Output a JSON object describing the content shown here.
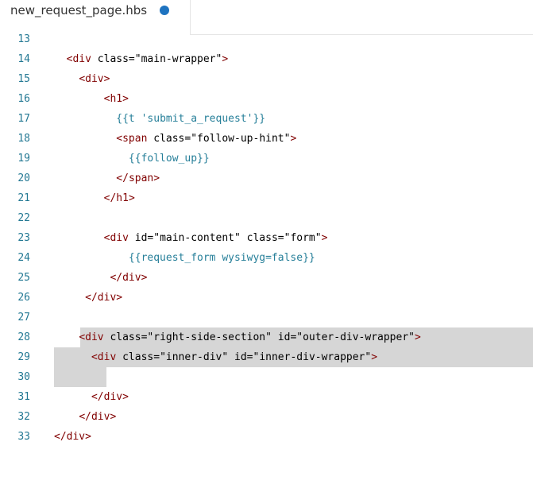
{
  "tab": {
    "title": "new_request_page.hbs",
    "dirty_indicator": "unsaved-dot"
  },
  "colors": {
    "line_number": "#237893",
    "tag": "#800000",
    "attribute": "#e50000",
    "string": "#a31515",
    "selection": "#d6d6d6",
    "dirty_dot": "#1e73c0"
  },
  "lines": [
    {
      "num": "13",
      "text": ""
    },
    {
      "num": "14",
      "text": "  <div class=\"main-wrapper\">"
    },
    {
      "num": "15",
      "text": "    <div>"
    },
    {
      "num": "16",
      "text": "        <h1>"
    },
    {
      "num": "17",
      "text": "          {{t 'submit_a_request'}}"
    },
    {
      "num": "18",
      "text": "          <span class=\"follow-up-hint\">"
    },
    {
      "num": "19",
      "text": "            {{follow_up}}"
    },
    {
      "num": "20",
      "text": "          </span>"
    },
    {
      "num": "21",
      "text": "        </h1>"
    },
    {
      "num": "22",
      "text": ""
    },
    {
      "num": "23",
      "text": "        <div id=\"main-content\" class=\"form\">"
    },
    {
      "num": "24",
      "text": "            {{request_form wysiwyg=false}}"
    },
    {
      "num": "25",
      "text": "         </div>"
    },
    {
      "num": "26",
      "text": "     </div>"
    },
    {
      "num": "27",
      "text": ""
    },
    {
      "num": "28",
      "text": "    <div class=\"right-side-section\" id=\"outer-div-wrapper\">"
    },
    {
      "num": "29",
      "text": "      <div class=\"inner-div\" id=\"inner-div-wrapper\">"
    },
    {
      "num": "30",
      "text": ""
    },
    {
      "num": "31",
      "text": "      </div>"
    },
    {
      "num": "32",
      "text": "    </div>"
    },
    {
      "num": "33",
      "text": "</div>"
    }
  ]
}
